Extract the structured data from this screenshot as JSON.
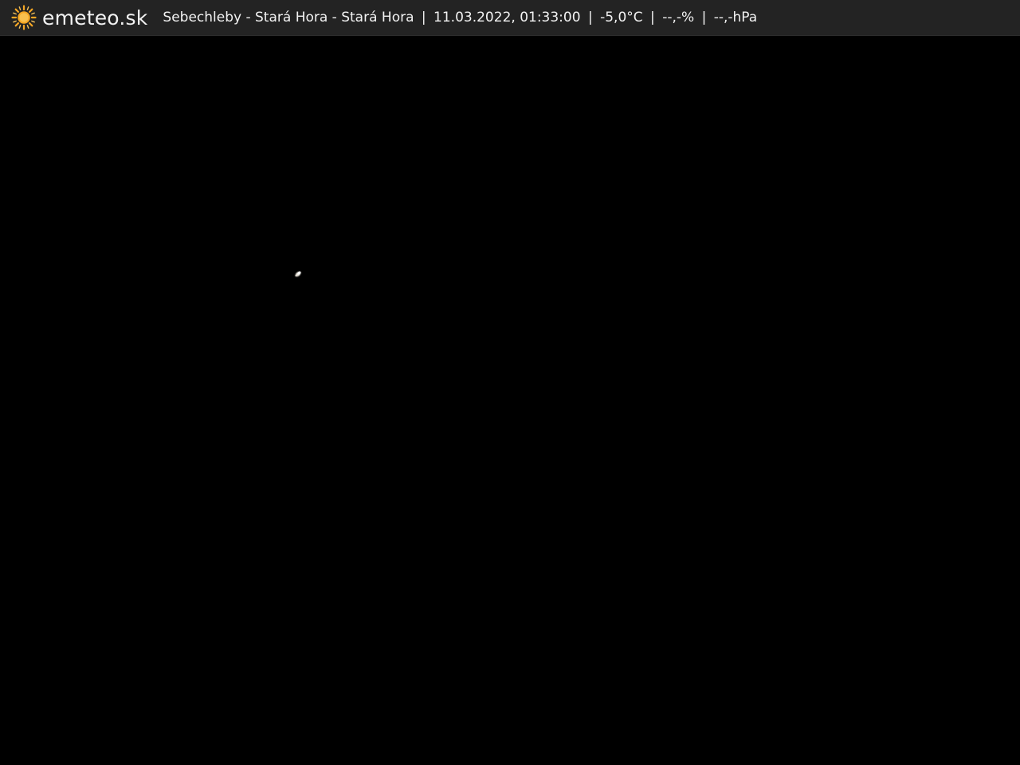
{
  "header": {
    "brand": "emeteo.sk",
    "logo_icon": "sun-icon",
    "location": "Sebechleby - Stará Hora - Stará Hora",
    "datetime": "11.03.2022, 01:33:00",
    "temperature": "-5,0°C",
    "humidity": "--,-%",
    "pressure": "--,-hPa",
    "separator": "|"
  },
  "colors": {
    "header_bg": "#232323",
    "header_text": "#f2f2f2",
    "scene_bg": "#000000",
    "sun_accent": "#f5a623"
  }
}
